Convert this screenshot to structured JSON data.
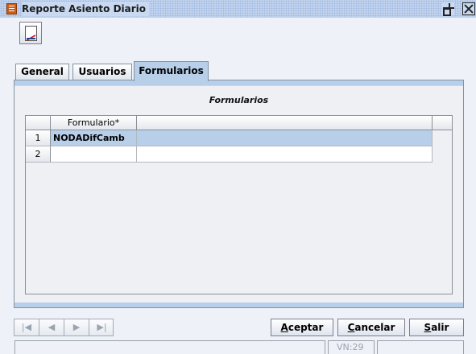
{
  "window": {
    "title": "Reporte Asiento Diario"
  },
  "tabs": [
    {
      "label": "General"
    },
    {
      "label": "Usuarios"
    },
    {
      "label": "Formularios"
    }
  ],
  "panel": {
    "section_title": "Formularios",
    "grid": {
      "columns": [
        "Formulario*",
        ""
      ],
      "rows": [
        {
          "num": "1",
          "formulario": "NODADifCamb",
          "selected": true
        },
        {
          "num": "2",
          "formulario": ""
        }
      ]
    }
  },
  "navigation": {
    "first": "|◀",
    "prev": "◀",
    "next": "▶",
    "last": "▶|"
  },
  "buttons": {
    "aceptar": {
      "mnemonic": "A",
      "rest": "ceptar"
    },
    "cancelar": {
      "mnemonic": "C",
      "rest": "ancelar"
    },
    "salir": {
      "mnemonic": "S",
      "rest": "alir"
    }
  },
  "status": {
    "vn": "VN:29"
  },
  "colors": {
    "selected_row": "#b8cfe9",
    "active_tab": "#b8cfe9",
    "titlebar": "#c9d9f1"
  }
}
